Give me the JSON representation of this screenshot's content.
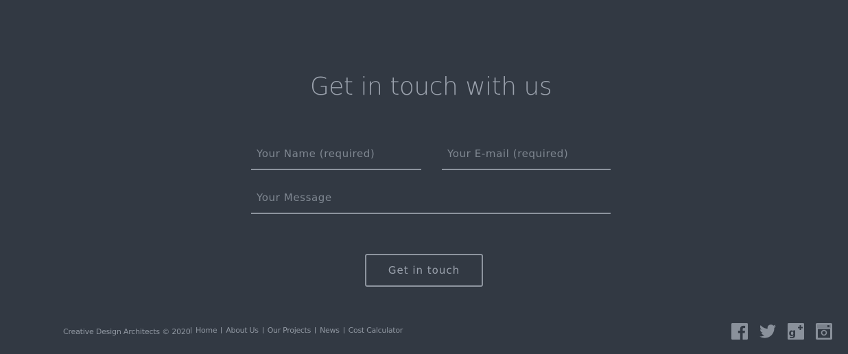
{
  "contact": {
    "title": "Get in touch with us",
    "name_placeholder": "Your Name (required)",
    "email_placeholder": "Your E-mail (required)",
    "message_placeholder": "Your Message",
    "submit_label": "Get in touch"
  },
  "footer": {
    "copyright": "Creative Design Architects © 2020",
    "nav": [
      {
        "label": "Home"
      },
      {
        "label": "About Us"
      },
      {
        "label": "Our Projects"
      },
      {
        "label": "News"
      },
      {
        "label": "Cost Calculator"
      }
    ],
    "social": [
      "facebook-icon",
      "twitter-icon",
      "google-plus-icon",
      "instagram-icon"
    ]
  },
  "colors": {
    "background": "#323943",
    "text": "#9aa1ab",
    "line": "#8d949e"
  }
}
